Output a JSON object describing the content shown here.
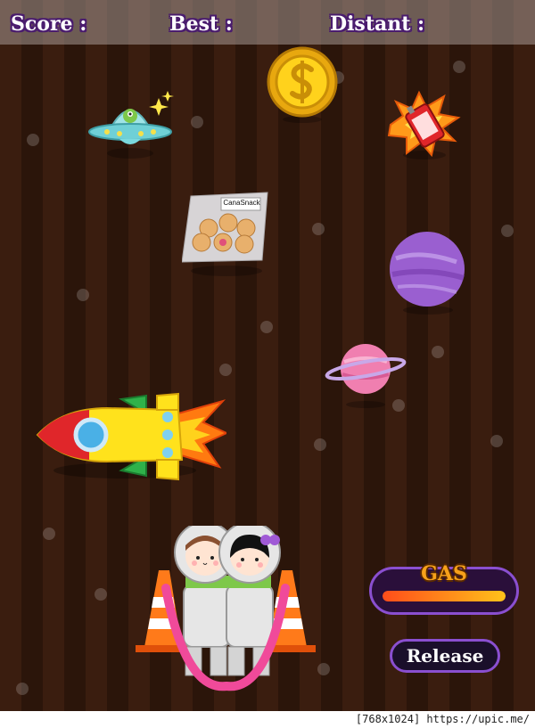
{
  "hud": {
    "score_label": "Score :",
    "best_label": "Best :",
    "distance_label": "Distant :"
  },
  "items": {
    "snack_label": "CanaSnack"
  },
  "gas": {
    "label": "GAS",
    "level": 1.0
  },
  "controls": {
    "release_label": "Release"
  },
  "footer": {
    "watermark": "[768x1024] https://upic.me/"
  },
  "colors": {
    "accent": "#8a4fd0",
    "gas_text": "#f7a11a"
  }
}
